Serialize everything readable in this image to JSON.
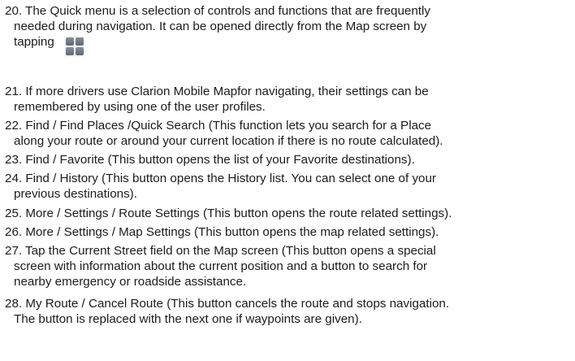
{
  "items": [
    {
      "lines": [
        "20. The Quick menu is a selection of controls and functions that are frequently",
        "needed during navigation. It can be opened directly from the Map screen by",
        "tapping"
      ],
      "icon": "quick-menu-icon"
    },
    {
      "lines": [
        "21. If more drivers use Clarion Mobile Mapfor navigating, their settings can be",
        "remembered by using one of the user profiles."
      ]
    },
    {
      "lines": [
        "22. Find / Find Places /Quick Search (This function lets you search for a Place",
        "along your route or around your current location if there is no route calculated)."
      ]
    },
    {
      "lines": [
        "23. Find / Favorite (This button opens the list of your Favorite destinations)."
      ]
    },
    {
      "lines": [
        "24. Find / History (This button opens the History list. You can select one of your",
        "previous destinations)."
      ]
    },
    {
      "lines": [
        "25. More / Settings / Route Settings (This button opens the route related settings)."
      ]
    },
    {
      "lines": [
        "26. More / Settings / Map Settings (This button opens the map related settings)."
      ]
    },
    {
      "lines": [
        "27. Tap the Current Street field on the Map screen (This button opens a special",
        "screen with information about the current position and a button to search for",
        "nearby emergency or roadside assistance."
      ]
    },
    {
      "lines": [
        "28. My Route / Cancel Route (This button cancels the route and stops navigation.",
        "The button is replaced with the next one if waypoints are given)."
      ]
    }
  ]
}
